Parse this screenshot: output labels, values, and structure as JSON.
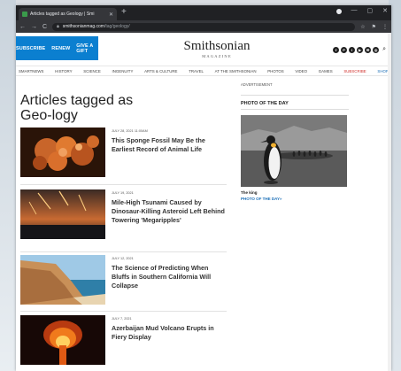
{
  "browser": {
    "tab_title": "Articles tagged as Geology | Smi",
    "tab_close": "✕",
    "new_tab": "+",
    "window_controls": [
      "—",
      "▢",
      "✕"
    ],
    "nav_back": "←",
    "nav_forward": "→",
    "nav_reload": "C",
    "url_host": "smithsonianmag.com",
    "url_path": "/tag/geology/",
    "toolbar_icons": [
      "☆",
      "⚑",
      "⋮"
    ]
  },
  "header": {
    "subscribe": "SUBSCRIBE",
    "renew": "RENEW",
    "give_gift": "GIVE A GIFT",
    "logo_main": "Smithsonian",
    "logo_sub": "MAGAZINE",
    "social": [
      "f",
      "P",
      "I",
      "▶",
      "✉",
      "◎"
    ],
    "search_icon": "⌕"
  },
  "nav": [
    "SMARTNEWS",
    "HISTORY",
    "SCIENCE",
    "INGENUITY",
    "ARTS & CULTURE",
    "TRAVEL",
    "AT THE SMITHSONIAN",
    "PHOTOS",
    "VIDEO",
    "GAMES",
    "SUBSCRIBE",
    "SHOP"
  ],
  "page": {
    "title": "Articles tagged as Geo-logy"
  },
  "articles": [
    {
      "date": "JULY 28, 2021 11:00AM",
      "title": "This Sponge Fossil May Be the Earliest Record of Animal Life"
    },
    {
      "date": "JULY 19, 2021",
      "title": "Mile-High Tsunami Caused by Dinosaur-Killing Asteroid Left Behind Towering 'Megaripples'"
    },
    {
      "date": "JULY 12, 2021",
      "title": "The Science of Predicting When Bluffs in Southern California Will Collapse"
    },
    {
      "date": "JULY 7, 2021",
      "title": "Azerbaijan Mud Volcano Erupts in Fiery Display"
    }
  ],
  "sidebar": {
    "advertisement": "ADVERTISEMENT",
    "photo_heading": "PHOTO OF THE DAY",
    "caption": "The king",
    "link": "PHOTO OF THE DAY»"
  },
  "colors": {
    "brand_blue": "#0b7fd0",
    "link_blue": "#1d70b8",
    "subscribe_red": "#d0312d"
  }
}
